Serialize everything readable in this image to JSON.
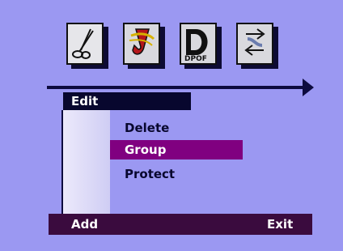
{
  "toolbar": {
    "icons": [
      {
        "name": "scissors-icon"
      },
      {
        "name": "jump-icon"
      },
      {
        "name": "dpof-icon",
        "label": "DPOF"
      },
      {
        "name": "transfer-icon"
      }
    ]
  },
  "menu": {
    "title": "Edit",
    "items": [
      {
        "label": "Delete",
        "selected": false
      },
      {
        "label": "Group",
        "selected": true
      },
      {
        "label": "Protect",
        "selected": false
      }
    ]
  },
  "footer": {
    "left": "Add",
    "right": "Exit"
  },
  "colors": {
    "background": "#9b98f2",
    "highlight": "#800080",
    "bar": "#3a0b3e"
  }
}
